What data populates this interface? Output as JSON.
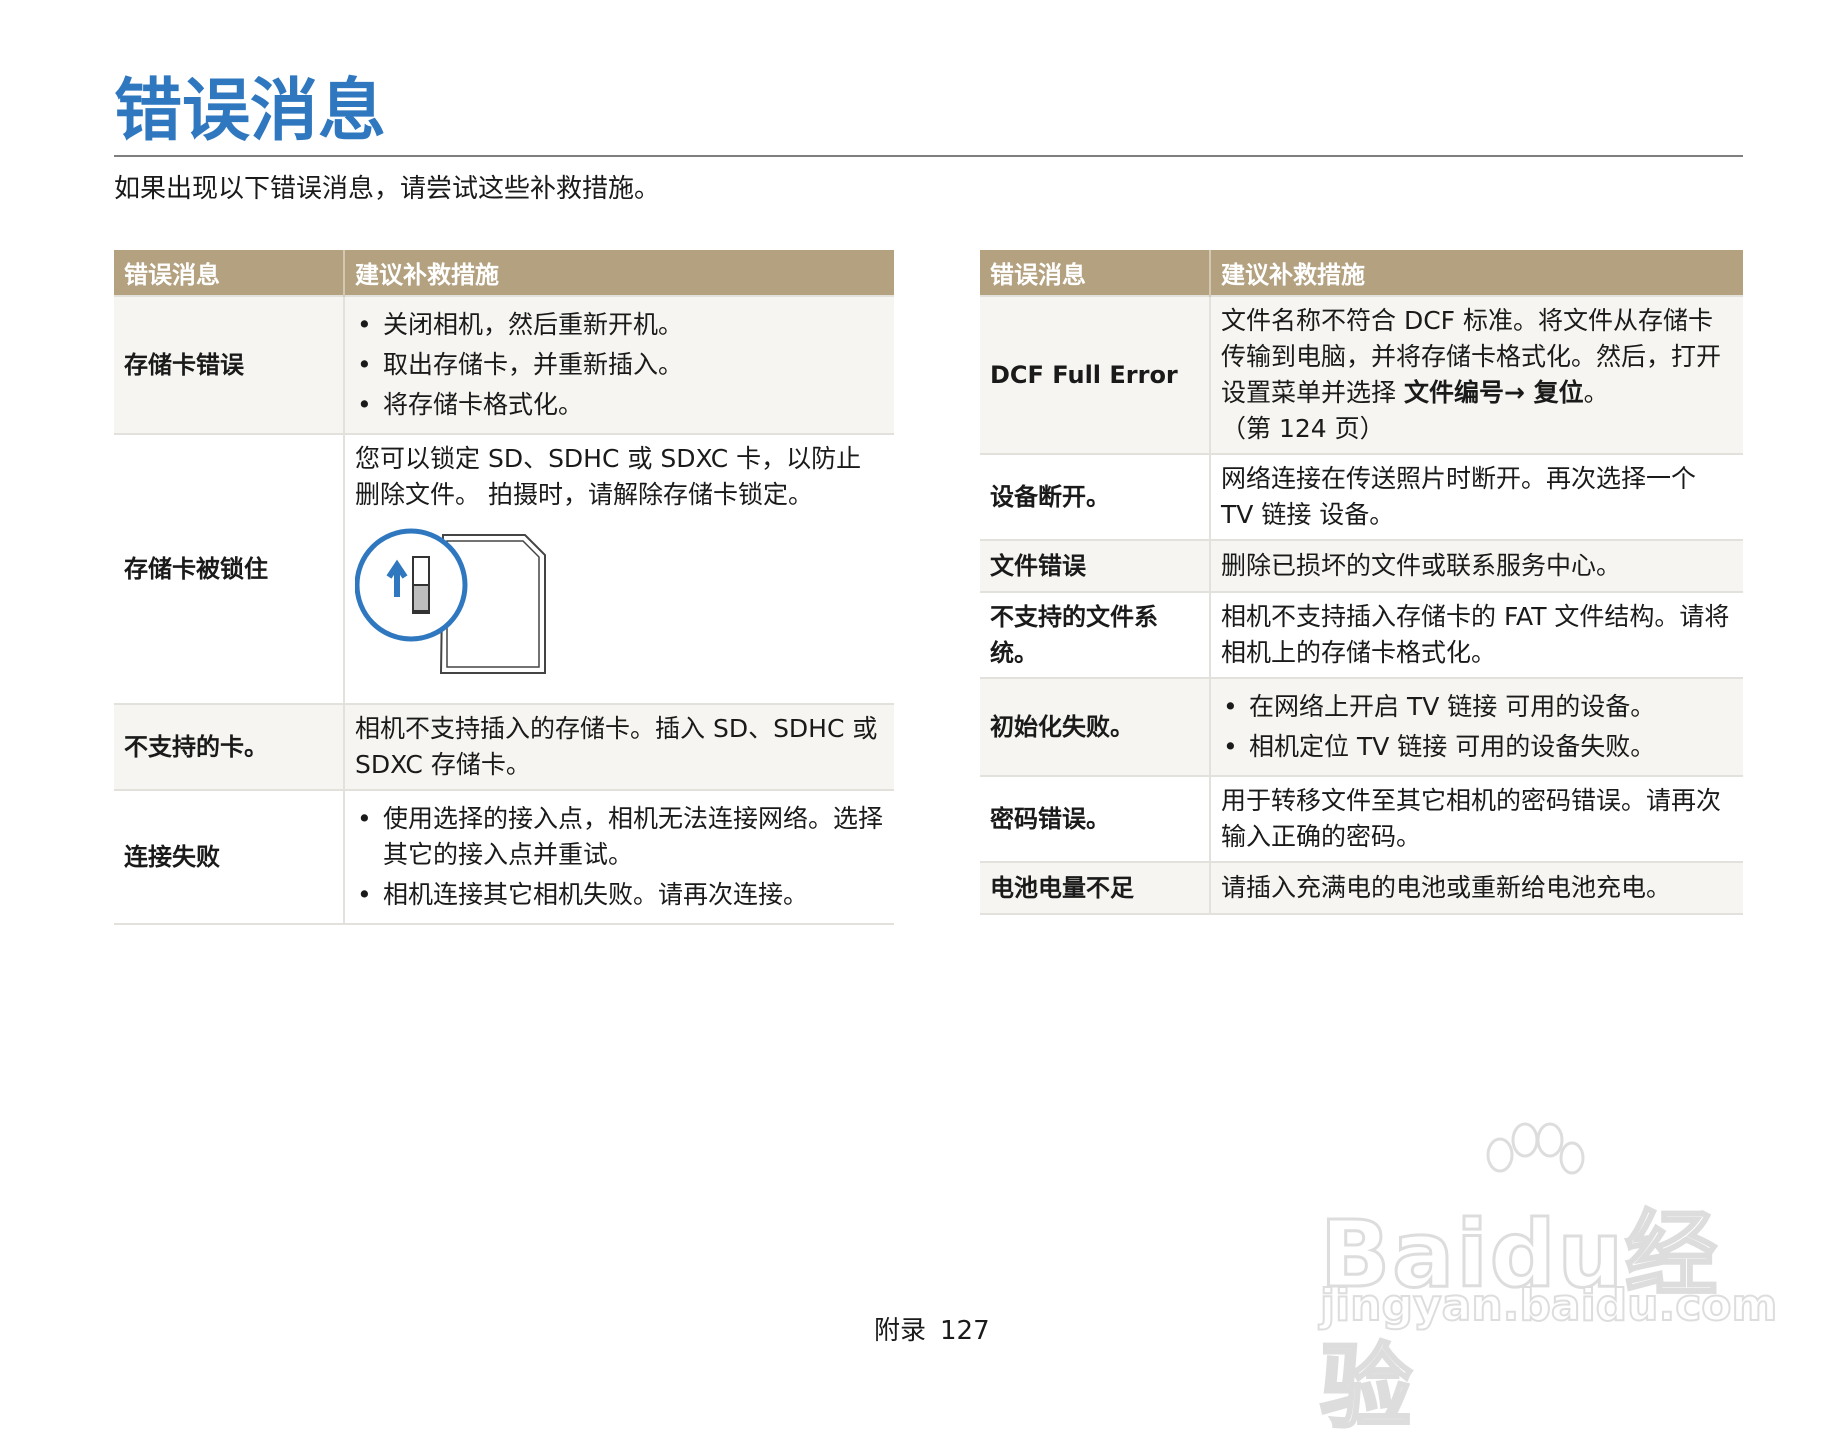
{
  "page": {
    "title": "错误消息",
    "intro": "如果出现以下错误消息，请尝试这些补救措施。",
    "footer_section": "附录",
    "footer_page": "127"
  },
  "left_table": {
    "header_message": "错误消息",
    "header_remedy": "建议补救措施",
    "rows": [
      {
        "name": "存储卡错误",
        "bullets": [
          "关闭相机，然后重新开机。",
          "取出存储卡，并重新插入。",
          "将存储卡格式化。"
        ]
      },
      {
        "name": "存储卡被锁住",
        "text": "您可以锁定 SD、SDHC 或 SDXC 卡，以防止删除文件。 拍摄时，请解除存储卡锁定。"
      },
      {
        "name": "不支持的卡。",
        "text": "相机不支持插入的存储卡。插入 SD、SDHC 或 SDXC 存储卡。"
      },
      {
        "name": "连接失败",
        "bullets": [
          "使用选择的接入点，相机无法连接网络。选择其它的接入点并重试。",
          "相机连接其它相机失败。请再次连接。"
        ]
      }
    ]
  },
  "right_table": {
    "header_message": "错误消息",
    "header_remedy": "建议补救措施",
    "rows": [
      {
        "name": "DCF Full Error",
        "text_before": "文件名称不符合 DCF 标准。将文件从存储卡传输到电脑，并将存储卡格式化。然后，打开设置菜单并选择 ",
        "bold": "文件编号→ 复位",
        "text_after": "。",
        "page_ref": "（第 124 页）"
      },
      {
        "name": "设备断开。",
        "text": "网络连接在传送照片时断开。再次选择一个 TV 链接 设备。"
      },
      {
        "name": "文件错误",
        "text": "删除已损坏的文件或联系服务中心。"
      },
      {
        "name": "不支持的文件系统。",
        "text": "相机不支持插入存储卡的 FAT 文件结构。请将相机上的存储卡格式化。"
      },
      {
        "name": "初始化失败。",
        "bullets": [
          "在网络上开启 TV 链接 可用的设备。",
          "相机定位 TV 链接 可用的设备失败。"
        ]
      },
      {
        "name": "密码错误。",
        "text": "用于转移文件至其它相机的密码错误。请再次输入正确的密码。"
      },
      {
        "name": "电池电量不足",
        "text": "请插入充满电的电池或重新给电池充电。"
      }
    ]
  },
  "watermark": {
    "brand": "Baidu经验",
    "url": "jingyan.baidu.com"
  },
  "colors": {
    "title": "#2f78c0",
    "header_bg": "#b3a180",
    "row_alt_bg": "#f6f5f1",
    "sd_highlight": "#2f78c0"
  }
}
